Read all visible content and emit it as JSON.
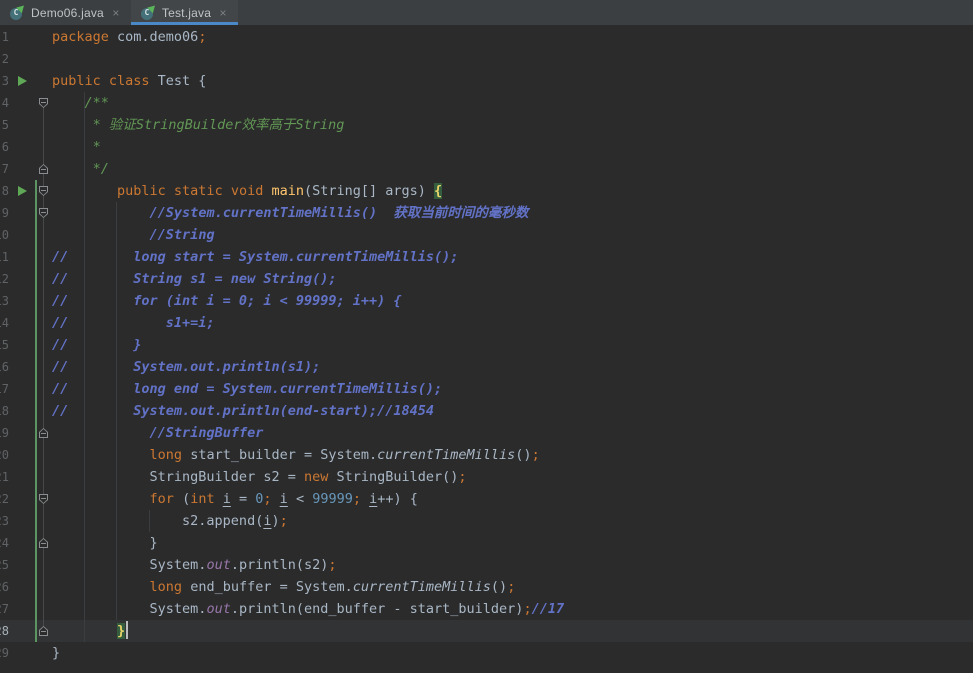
{
  "tabs": [
    {
      "label": "Demo06.java",
      "active": false
    },
    {
      "label": "Test.java",
      "active": true
    }
  ],
  "icons": {
    "close": "×",
    "class_letter": "C",
    "run_arrow": "green-play-triangle",
    "java_class": "teal-circle-with-run-overlay"
  },
  "colors": {
    "editor_bg": "#2B2B2B",
    "tab_bar_bg": "#3C3F41",
    "active_tab_underline": "#4A88C7",
    "keyword": "#CC7832",
    "plain_text": "#A9B7C6",
    "line_comment": "#6272C7",
    "doc_comment": "#629755",
    "number_literal": "#6897BB",
    "method_name": "#FFC66D",
    "static_field": "#9876AA",
    "matched_brace_bg": "#355E3F",
    "matched_brace_text": "#E9D56A",
    "vcs_added_bar": "#5C9462",
    "caret_row_bg": "#323334",
    "line_number": "#606366",
    "run_icon": "#5FA856"
  },
  "editor": {
    "lines": [
      {
        "num": "1",
        "segments": [
          {
            "t": "package ",
            "s": "kw"
          },
          {
            "t": "com.demo06",
            "s": "txt"
          },
          {
            "t": ";",
            "s": "kw"
          }
        ]
      },
      {
        "num": "2",
        "segments": []
      },
      {
        "num": "3",
        "run": true,
        "segments": [
          {
            "t": "public class ",
            "s": "kw"
          },
          {
            "t": "Test {",
            "s": "txt"
          }
        ]
      },
      {
        "num": "4",
        "fold": "down",
        "segments": [
          {
            "t": "    /**",
            "s": "doc"
          }
        ]
      },
      {
        "num": "5",
        "segments": [
          {
            "t": "     * 验证StringBuilder效率高于String",
            "s": "doc"
          }
        ]
      },
      {
        "num": "6",
        "segments": [
          {
            "t": "     *",
            "s": "doc"
          }
        ]
      },
      {
        "num": "7",
        "fold": "up",
        "segments": [
          {
            "t": "     */",
            "s": "doc"
          }
        ]
      },
      {
        "num": "8",
        "run": true,
        "fold": "down",
        "segments": [
          {
            "t": "        ",
            "s": "txt"
          },
          {
            "t": "public static void ",
            "s": "kw"
          },
          {
            "t": "main",
            "s": "fn"
          },
          {
            "t": "(String[] args) ",
            "s": "txt"
          },
          {
            "t": "{",
            "s": "brace"
          }
        ]
      },
      {
        "num": "9",
        "fold": "down",
        "segments": [
          {
            "t": "            ",
            "s": "txt"
          },
          {
            "t": "//System.currentTimeMillis()  获取当前时间的毫秒数",
            "s": "cm"
          }
        ]
      },
      {
        "num": "10",
        "segments": [
          {
            "t": "            ",
            "s": "txt"
          },
          {
            "t": "//String",
            "s": "cm"
          }
        ]
      },
      {
        "num": "11",
        "segments": [
          {
            "t": "//        long start = System.currentTimeMillis();",
            "s": "cm"
          }
        ]
      },
      {
        "num": "12",
        "segments": [
          {
            "t": "//        String s1 = new String();",
            "s": "cm"
          }
        ]
      },
      {
        "num": "13",
        "segments": [
          {
            "t": "//        for (int i = 0; i < 99999; i++) {",
            "s": "cm"
          }
        ]
      },
      {
        "num": "14",
        "segments": [
          {
            "t": "//            s1+=i;",
            "s": "cm"
          }
        ]
      },
      {
        "num": "15",
        "segments": [
          {
            "t": "//        }",
            "s": "cm"
          }
        ]
      },
      {
        "num": "16",
        "segments": [
          {
            "t": "//        System.out.println(s1);",
            "s": "cm"
          }
        ]
      },
      {
        "num": "17",
        "segments": [
          {
            "t": "//        long end = System.currentTimeMillis();",
            "s": "cm"
          }
        ]
      },
      {
        "num": "18",
        "segments": [
          {
            "t": "//        System.out.println(end-start);//18454",
            "s": "cm"
          }
        ]
      },
      {
        "num": "19",
        "fold": "up",
        "segments": [
          {
            "t": "            ",
            "s": "txt"
          },
          {
            "t": "//StringBuffer",
            "s": "cm"
          }
        ]
      },
      {
        "num": "20",
        "segments": [
          {
            "t": "            ",
            "s": "txt"
          },
          {
            "t": "long ",
            "s": "kw"
          },
          {
            "t": "start_builder = System.",
            "s": "txt"
          },
          {
            "t": "currentTimeMillis",
            "s": "sm"
          },
          {
            "t": "()",
            "s": "txt"
          },
          {
            "t": ";",
            "s": "kw"
          }
        ]
      },
      {
        "num": "21",
        "segments": [
          {
            "t": "            StringBuilder s2 = ",
            "s": "txt"
          },
          {
            "t": "new ",
            "s": "kw"
          },
          {
            "t": "StringBuilder()",
            "s": "txt"
          },
          {
            "t": ";",
            "s": "kw"
          }
        ]
      },
      {
        "num": "22",
        "fold": "down",
        "segments": [
          {
            "t": "            ",
            "s": "txt"
          },
          {
            "t": "for ",
            "s": "kw"
          },
          {
            "t": "(",
            "s": "txt"
          },
          {
            "t": "int ",
            "s": "kw"
          },
          {
            "t": "i",
            "s": "und"
          },
          {
            "t": " = ",
            "s": "txt"
          },
          {
            "t": "0",
            "s": "numlit"
          },
          {
            "t": ";",
            "s": "kw"
          },
          {
            "t": " ",
            "s": "txt"
          },
          {
            "t": "i",
            "s": "und"
          },
          {
            "t": " < ",
            "s": "txt"
          },
          {
            "t": "99999",
            "s": "numlit"
          },
          {
            "t": ";",
            "s": "kw"
          },
          {
            "t": " ",
            "s": "txt"
          },
          {
            "t": "i",
            "s": "und"
          },
          {
            "t": "++) {",
            "s": "txt"
          }
        ]
      },
      {
        "num": "23",
        "segments": [
          {
            "t": "                s2.append(",
            "s": "txt"
          },
          {
            "t": "i",
            "s": "und"
          },
          {
            "t": ")",
            "s": "txt"
          },
          {
            "t": ";",
            "s": "kw"
          }
        ]
      },
      {
        "num": "24",
        "fold": "up",
        "segments": [
          {
            "t": "            }",
            "s": "txt"
          }
        ]
      },
      {
        "num": "25",
        "segments": [
          {
            "t": "            System.",
            "s": "txt"
          },
          {
            "t": "out",
            "s": "field"
          },
          {
            "t": ".println(s2)",
            "s": "txt"
          },
          {
            "t": ";",
            "s": "kw"
          }
        ]
      },
      {
        "num": "26",
        "segments": [
          {
            "t": "            ",
            "s": "txt"
          },
          {
            "t": "long ",
            "s": "kw"
          },
          {
            "t": "end_buffer = System.",
            "s": "txt"
          },
          {
            "t": "currentTimeMillis",
            "s": "sm"
          },
          {
            "t": "()",
            "s": "txt"
          },
          {
            "t": ";",
            "s": "kw"
          }
        ]
      },
      {
        "num": "27",
        "segments": [
          {
            "t": "            System.",
            "s": "txt"
          },
          {
            "t": "out",
            "s": "field"
          },
          {
            "t": ".println(end_buffer - start_builder)",
            "s": "txt"
          },
          {
            "t": ";",
            "s": "kw"
          },
          {
            "t": "//17",
            "s": "cm"
          }
        ]
      },
      {
        "num": "28",
        "current": true,
        "caret": true,
        "fold": "up",
        "segments": [
          {
            "t": "        ",
            "s": "txt"
          },
          {
            "t": "}",
            "s": "brace"
          }
        ]
      },
      {
        "num": "29",
        "segments": [
          {
            "t": "}",
            "s": "txt"
          }
        ]
      }
    ]
  }
}
